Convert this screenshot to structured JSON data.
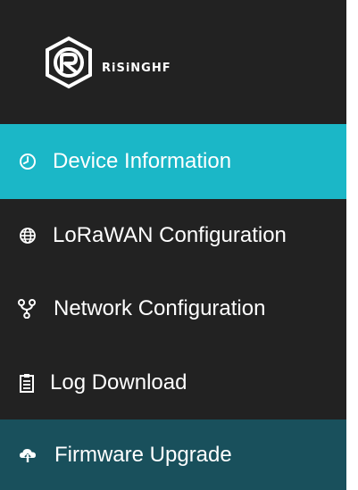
{
  "brand": {
    "name": "RiSiNGHF"
  },
  "nav": {
    "items": [
      {
        "label": "Device Information",
        "icon": "clock-icon",
        "state": "active"
      },
      {
        "label": "LoRaWAN Configuration",
        "icon": "globe-icon",
        "state": "normal"
      },
      {
        "label": "Network Configuration",
        "icon": "network-icon",
        "state": "normal"
      },
      {
        "label": "Log Download",
        "icon": "clipboard-icon",
        "state": "normal"
      },
      {
        "label": "Firmware Upgrade",
        "icon": "cloud-upload-icon",
        "state": "highlighted"
      }
    ]
  },
  "colors": {
    "sidebar_bg": "#222222",
    "active_bg": "#1bb7c7",
    "highlight_bg": "#19505c",
    "text": "#ffffff"
  }
}
